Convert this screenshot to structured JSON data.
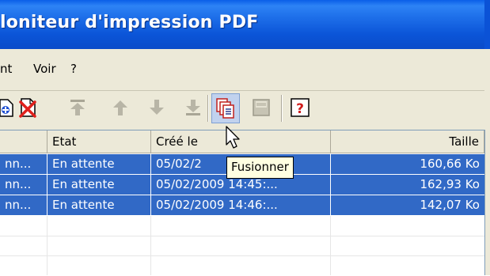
{
  "window": {
    "title": "loniteur d'impression PDF"
  },
  "menu": {
    "items": [
      "nt",
      "Voir",
      "?"
    ]
  },
  "toolbar": {
    "buttons": [
      "document-add-icon",
      "document-delete-icon",
      "move-top-icon",
      "move-up-icon",
      "move-down-icon",
      "move-bottom-icon",
      "merge-icon",
      "save-icon",
      "help-icon"
    ],
    "tooltip": "Fusionner"
  },
  "table": {
    "columns": [
      "",
      "Etat",
      "Créé le",
      "Taille"
    ],
    "rows": [
      {
        "name": "nn...",
        "status": "En attente",
        "created": "05/02/2",
        "size": "160,66 Ko"
      },
      {
        "name": "nn...",
        "status": "En attente",
        "created": "05/02/2009 14:45:...",
        "size": "162,93 Ko"
      },
      {
        "name": "nn...",
        "status": "En attente",
        "created": "05/02/2009 14:46:...",
        "size": "142,07 Ko"
      }
    ]
  },
  "colors": {
    "title_bar": "#0a4bc9",
    "selection": "#3169c6",
    "tooltip_bg": "#ffffe1"
  }
}
